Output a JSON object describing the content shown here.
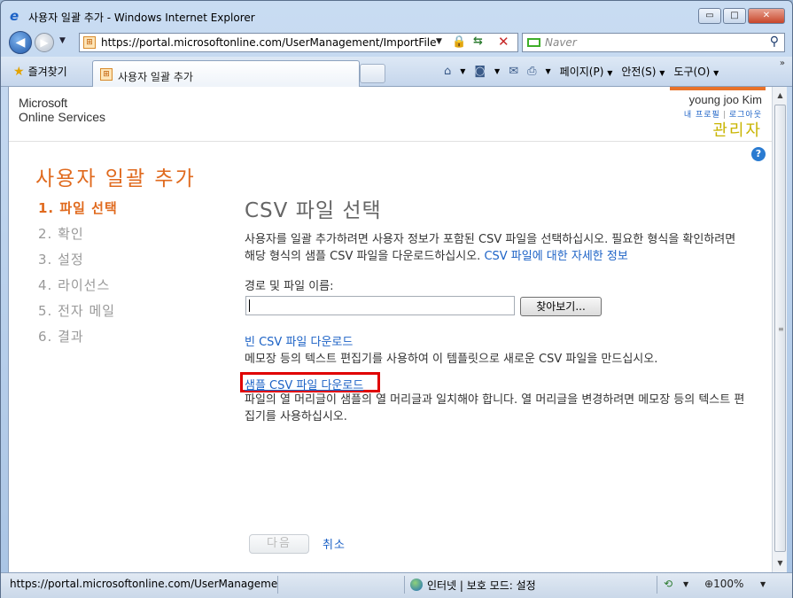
{
  "window": {
    "title": "사용자 일괄 추가 - Windows Internet Explorer",
    "minimize_label": "▭",
    "maximize_label": "□",
    "close_label": "✕"
  },
  "address_bar": {
    "url": "https://portal.microsoftonline.com/UserManagement/ImportFile.aspx",
    "search_placeholder": "Naver"
  },
  "command_bar": {
    "favorites_label": "즐겨찾기",
    "tab_title": "사용자 일괄 추가",
    "page_menu": "페이지(P)",
    "safety_menu": "안전(S)",
    "tools_menu": "도구(O)"
  },
  "header": {
    "brand_line1": "Microsoft",
    "brand_line2": "Online Services",
    "user_name": "young joo Kim",
    "my_profile": "내 프로필",
    "logout": "로그아웃",
    "role": "관리자"
  },
  "page": {
    "title": "사용자 일괄 추가",
    "help_label": "?"
  },
  "steps": [
    {
      "label": "1. 파일 선택",
      "active": true
    },
    {
      "label": "2. 확인",
      "active": false
    },
    {
      "label": "3. 설정",
      "active": false
    },
    {
      "label": "4. 라이선스",
      "active": false
    },
    {
      "label": "5. 전자 메일",
      "active": false
    },
    {
      "label": "6. 결과",
      "active": false
    }
  ],
  "main": {
    "section_title": "CSV 파일 선택",
    "description": "사용자를 일괄 추가하려면 사용자 정보가 포함된 CSV 파일을 선택하십시오. 필요한 형식을 확인하려면 해당 형식의 샘플 CSV 파일을 다운로드하십시오.",
    "details_link": "CSV 파일에 대한 자세한 정보",
    "path_label": "경로 및 파일 이름:",
    "file_value": "",
    "browse_label": "찾아보기...",
    "blank_csv_link": "빈 CSV 파일 다운로드",
    "blank_csv_desc": "메모장 등의 텍스트 편집기를 사용하여 이 템플릿으로 새로운 CSV 파일을 만드십시오.",
    "sample_csv_link": "샘플 CSV 파일 다운로드",
    "sample_csv_desc": "파일의 열 머리글이 샘플의 열 머리글과 일치해야 합니다. 열 머리글을 변경하려면 메모장 등의 텍스트 편집기를 사용하십시오.",
    "next_label": "다음",
    "cancel_label": "취소"
  },
  "status_bar": {
    "url": "https://portal.microsoftonline.com/UserManagement/Sa",
    "zone": "인터넷 | 보호 모드: 설정",
    "zoom": "100%"
  },
  "colors": {
    "accent_orange": "#e06a1e",
    "link_blue": "#1c62c6",
    "role_yellow": "#c8b400",
    "highlight_red": "#e00000"
  }
}
